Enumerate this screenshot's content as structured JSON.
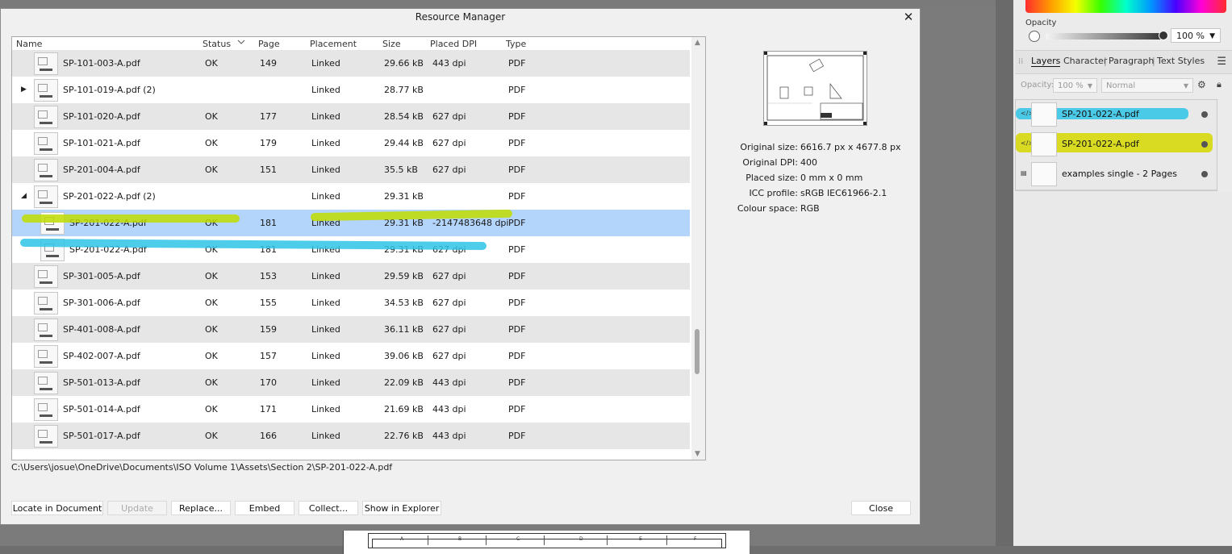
{
  "dialog": {
    "title": "Resource Manager",
    "close_glyph": "✕",
    "columns": [
      "Name",
      "Status",
      "Page",
      "Placement",
      "Size",
      "Placed DPI",
      "Type"
    ],
    "rows": [
      {
        "name": "SP-101-003-A.pdf",
        "status": "OK",
        "page": "149",
        "placement": "Linked",
        "size": "29.66 kB",
        "dpi": "443 dpi",
        "type": "PDF"
      },
      {
        "name": "SP-101-019-A.pdf (2)",
        "status": "",
        "page": "",
        "placement": "Linked",
        "size": "28.77 kB",
        "dpi": "",
        "type": "PDF",
        "expander": "▶"
      },
      {
        "name": "SP-101-020-A.pdf",
        "status": "OK",
        "page": "177",
        "placement": "Linked",
        "size": "28.54 kB",
        "dpi": "627 dpi",
        "type": "PDF"
      },
      {
        "name": "SP-101-021-A.pdf",
        "status": "OK",
        "page": "179",
        "placement": "Linked",
        "size": "29.44 kB",
        "dpi": "627 dpi",
        "type": "PDF"
      },
      {
        "name": "SP-201-004-A.pdf",
        "status": "OK",
        "page": "151",
        "placement": "Linked",
        "size": "35.5 kB",
        "dpi": "627 dpi",
        "type": "PDF"
      },
      {
        "name": "SP-201-022-A.pdf (2)",
        "status": "",
        "page": "",
        "placement": "Linked",
        "size": "29.31 kB",
        "dpi": "",
        "type": "PDF",
        "expander": "◢"
      },
      {
        "name": "SP-201-022-A.pdf",
        "status": "OK",
        "page": "181",
        "placement": "Linked",
        "size": "29.31 kB",
        "dpi": "-2147483648 dpi",
        "type": "PDF",
        "child": true,
        "selected": true
      },
      {
        "name": "SP-201-022-A.pdf",
        "status": "OK",
        "page": "181",
        "placement": "Linked",
        "size": "29.31 kB",
        "dpi": "627 dpi",
        "type": "PDF",
        "child": true
      },
      {
        "name": "SP-301-005-A.pdf",
        "status": "OK",
        "page": "153",
        "placement": "Linked",
        "size": "29.59 kB",
        "dpi": "627 dpi",
        "type": "PDF"
      },
      {
        "name": "SP-301-006-A.pdf",
        "status": "OK",
        "page": "155",
        "placement": "Linked",
        "size": "34.53 kB",
        "dpi": "627 dpi",
        "type": "PDF"
      },
      {
        "name": "SP-401-008-A.pdf",
        "status": "OK",
        "page": "159",
        "placement": "Linked",
        "size": "36.11 kB",
        "dpi": "627 dpi",
        "type": "PDF"
      },
      {
        "name": "SP-402-007-A.pdf",
        "status": "OK",
        "page": "157",
        "placement": "Linked",
        "size": "39.06 kB",
        "dpi": "627 dpi",
        "type": "PDF"
      },
      {
        "name": "SP-501-013-A.pdf",
        "status": "OK",
        "page": "170",
        "placement": "Linked",
        "size": "22.09 kB",
        "dpi": "443 dpi",
        "type": "PDF"
      },
      {
        "name": "SP-501-014-A.pdf",
        "status": "OK",
        "page": "171",
        "placement": "Linked",
        "size": "21.69 kB",
        "dpi": "443 dpi",
        "type": "PDF"
      },
      {
        "name": "SP-501-017-A.pdf",
        "status": "OK",
        "page": "166",
        "placement": "Linked",
        "size": "22.76 kB",
        "dpi": "443 dpi",
        "type": "PDF"
      }
    ],
    "path": "C:\\Users\\josue\\OneDrive\\Documents\\ISO Volume 1\\Assets\\Section 2\\SP-201-022-A.pdf",
    "info": [
      {
        "label": "Original size:",
        "value": "6616.7 px x 4677.8 px"
      },
      {
        "label": "Original DPI:",
        "value": "400"
      },
      {
        "label": "Placed size:",
        "value": "0 mm x 0 mm"
      },
      {
        "label": "ICC profile:",
        "value": "sRGB IEC61966-2.1"
      },
      {
        "label": "Colour space:",
        "value": "RGB"
      }
    ],
    "buttons": {
      "locate": "Locate in Document",
      "update": "Update",
      "replace": "Replace...",
      "embed": "Embed",
      "collect": "Collect...",
      "explorer": "Show in Explorer",
      "close": "Close"
    },
    "highlight_colors": {
      "yellow": "#bfdc00",
      "cyan": "#2fc4e6"
    }
  },
  "panel": {
    "opacity_label": "Opacity",
    "opacity_value": "100 %",
    "tabs": [
      "Layers",
      "Character",
      "Paragraph",
      "Text Styles"
    ],
    "layer_opacity_label": "Opacity:",
    "layer_opacity_value": "100 %",
    "blend_mode": "Normal",
    "layers": [
      {
        "name": "SP-201-022-A.pdf",
        "type_icon": "</>",
        "highlight": "#2fc4e6"
      },
      {
        "name": "SP-201-022-A.pdf",
        "type_icon": "</>",
        "highlight": "#d6d800"
      },
      {
        "name": "examples single - 2 Pages",
        "type_icon": "▤"
      }
    ]
  },
  "document_strip": {
    "letters": [
      "A",
      "B",
      "C",
      "D",
      "E",
      "F"
    ]
  }
}
